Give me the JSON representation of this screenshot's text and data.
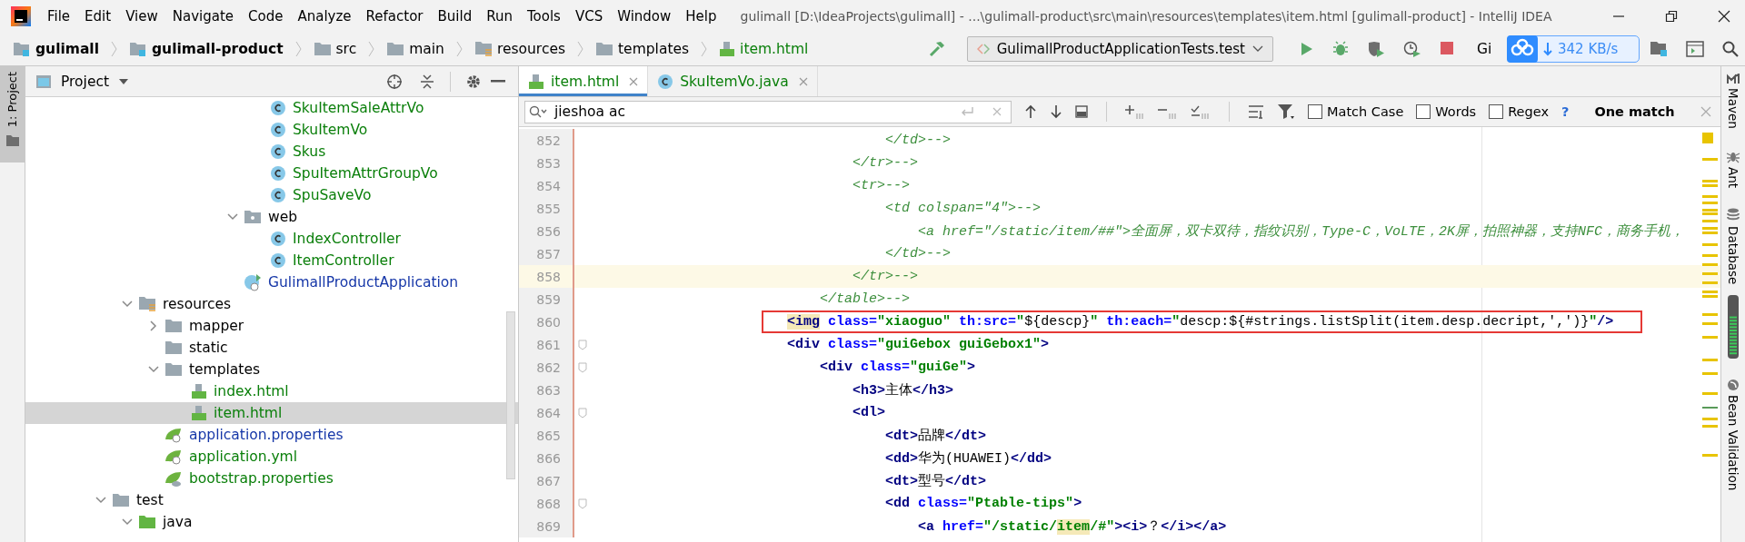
{
  "menu": [
    "File",
    "Edit",
    "View",
    "Navigate",
    "Code",
    "Analyze",
    "Refactor",
    "Build",
    "Run",
    "Tools",
    "VCS",
    "Window",
    "Help"
  ],
  "window": {
    "title": "gulimall [D:\\IdeaProjects\\gulimall] - ...\\gulimall-product\\src\\main\\resources\\templates\\item.html [gulimall-product] - IntelliJ IDEA"
  },
  "breadcrumbs": [
    {
      "label": "gulimall",
      "kind": "module"
    },
    {
      "label": "gulimall-product",
      "kind": "module"
    },
    {
      "label": "src",
      "kind": "folder"
    },
    {
      "label": "main",
      "kind": "folder"
    },
    {
      "label": "resources",
      "kind": "resources"
    },
    {
      "label": "templates",
      "kind": "folder"
    },
    {
      "label": "item.html",
      "kind": "html"
    }
  ],
  "toolbar": {
    "run_config": "GulimallProductApplicationTests.test",
    "vcs_label": "Gi",
    "speed_widget": "342 KB/s"
  },
  "left_stripe": {
    "label": "1: Project"
  },
  "project": {
    "title": "Project",
    "tree": [
      {
        "children": [
          {
            "children": [
              {
                "children": [
                  {
                    "children": [
                      {
                        "children": [
                          {
                            "children": [
                              {
                                "name": "SkuItemSaleAttrVo",
                                "kind": "class",
                                "color": "#0a7f0a",
                                "selected": false
                              },
                              {
                                "name": "SkuItemVo",
                                "kind": "class",
                                "color": "#0a7f0a",
                                "selected": false
                              },
                              {
                                "name": "Skus",
                                "kind": "class",
                                "color": "#0a7f0a",
                                "selected": false
                              },
                              {
                                "name": "SpuItemAttrGroupVo",
                                "kind": "class",
                                "color": "#0a7f0a",
                                "selected": false
                              },
                              {
                                "name": "SpuSaveVo",
                                "kind": "class",
                                "color": "#0a7f0a",
                                "selected": false
                              }
                            ]
                          },
                          {
                            "name": "web",
                            "kind": "package",
                            "color": "#000000",
                            "expanded": true,
                            "selected": false,
                            "children": [
                              {
                                "name": "IndexController",
                                "kind": "class",
                                "color": "#0a7f0a",
                                "selected": false
                              },
                              {
                                "name": "ItemController",
                                "kind": "class",
                                "color": "#0a7f0a",
                                "selected": false
                              }
                            ]
                          },
                          {
                            "name": "GulimallProductApplication",
                            "kind": "spring-class",
                            "color": "#1637a8",
                            "selected": false
                          }
                        ]
                      }
                    ]
                  }
                ]
              }
            ]
          },
          {
            "name": "resources",
            "kind": "resources",
            "color": "#000000",
            "expanded": true,
            "selected": false,
            "children": [
              {
                "name": "mapper",
                "kind": "folder",
                "color": "#000000",
                "expanded": false,
                "selected": false
              },
              {
                "name": "static",
                "kind": "folder",
                "color": "#000000",
                "selected": false
              },
              {
                "name": "templates",
                "kind": "folder",
                "color": "#000000",
                "expanded": true,
                "selected": false,
                "children": [
                  {
                    "name": "index.html",
                    "kind": "html",
                    "color": "#0a7f0a",
                    "selected": false
                  },
                  {
                    "name": "item.html",
                    "kind": "html",
                    "color": "#0a7f0a",
                    "selected": true
                  }
                ]
              },
              {
                "name": "application.properties",
                "kind": "spring-config",
                "color": "#1637a8",
                "selected": false
              },
              {
                "name": "application.yml",
                "kind": "spring-config",
                "color": "#0a7f0a",
                "selected": false
              },
              {
                "name": "bootstrap.properties",
                "kind": "spring-cloud",
                "color": "#0a7f0a",
                "selected": false
              }
            ]
          }
        ]
      },
      {
        "name": "test",
        "kind": "folder",
        "color": "#000000",
        "expanded": true,
        "selected": false,
        "children": [
          {
            "name": "java",
            "kind": "test-root",
            "color": "#000000",
            "expanded": true,
            "selected": false
          }
        ]
      }
    ]
  },
  "editor": {
    "tabs": [
      {
        "label": "item.html",
        "kind": "html",
        "selected": true
      },
      {
        "label": "SkuItemVo.java",
        "kind": "class",
        "selected": false
      }
    ],
    "find": {
      "value": "jieshoa ac",
      "options": [
        {
          "label": "Match Case",
          "checked": false
        },
        {
          "label": "Words",
          "checked": false
        },
        {
          "label": "Regex",
          "checked": false
        }
      ],
      "help": "?",
      "result": "One match"
    },
    "lines": [
      {
        "number": "852",
        "caret_line": false,
        "boxed": false,
        "fold_marker": false,
        "segments": [
          {
            "kind": "comment",
            "text": "                                    </td>-->"
          }
        ]
      },
      {
        "number": "853",
        "caret_line": false,
        "boxed": false,
        "fold_marker": false,
        "segments": [
          {
            "kind": "comment",
            "text": "                                </tr>-->"
          }
        ]
      },
      {
        "number": "854",
        "caret_line": false,
        "boxed": false,
        "fold_marker": false,
        "segments": [
          {
            "kind": "comment",
            "text": "                                <tr>-->"
          }
        ]
      },
      {
        "number": "855",
        "caret_line": false,
        "boxed": false,
        "fold_marker": false,
        "segments": [
          {
            "kind": "comment",
            "text": "                                    <td colspan=\"4\">-->"
          }
        ]
      },
      {
        "number": "856",
        "caret_line": false,
        "boxed": false,
        "fold_marker": false,
        "segments": [
          {
            "kind": "comment",
            "text": "                                        <a href=\"/static/item/##\">全面屏，双卡双待，指纹识别，Type-C，VoLTE，2K屏，拍照神器，支持NFC，商务手机，"
          }
        ]
      },
      {
        "number": "857",
        "caret_line": false,
        "boxed": false,
        "fold_marker": false,
        "segments": [
          {
            "kind": "comment",
            "text": "                                    </td>-->"
          }
        ]
      },
      {
        "number": "858",
        "caret_line": true,
        "boxed": false,
        "fold_marker": false,
        "segments": [
          {
            "kind": "comment",
            "text": "                                </tr>-->"
          }
        ]
      },
      {
        "number": "859",
        "caret_line": false,
        "boxed": false,
        "fold_marker": false,
        "segments": [
          {
            "kind": "comment",
            "text": "                            </table>-->"
          }
        ]
      },
      {
        "number": "860",
        "caret_line": false,
        "boxed": true,
        "fold_marker": false,
        "segments": [
          {
            "kind": "tag-match",
            "text": "                        <img"
          },
          {
            "kind": "attr",
            "text": " class="
          },
          {
            "kind": "value",
            "text": "\"xiaoguo\""
          },
          {
            "kind": "attr",
            "text": " th:src="
          },
          {
            "kind": "value",
            "text": "\""
          },
          {
            "kind": "expr",
            "text": "${descp}"
          },
          {
            "kind": "value",
            "text": "\""
          },
          {
            "kind": "attr",
            "text": " th:each="
          },
          {
            "kind": "value",
            "text": "\""
          },
          {
            "kind": "expr",
            "text": "descp:${#strings.listSplit(item.desp.decript,',')}"
          },
          {
            "kind": "value",
            "text": "\""
          },
          {
            "kind": "tag",
            "text": "/>"
          }
        ]
      },
      {
        "number": "861",
        "caret_line": false,
        "boxed": false,
        "fold_marker": true,
        "segments": [
          {
            "kind": "tag",
            "text": "                        <div"
          },
          {
            "kind": "attr",
            "text": " class="
          },
          {
            "kind": "value",
            "text": "\"guiGebox guiGebox1\""
          },
          {
            "kind": "tag",
            "text": ">"
          }
        ]
      },
      {
        "number": "862",
        "caret_line": false,
        "boxed": false,
        "fold_marker": true,
        "segments": [
          {
            "kind": "tag",
            "text": "                            <div"
          },
          {
            "kind": "attr",
            "text": " class="
          },
          {
            "kind": "value",
            "text": "\"guiGe\""
          },
          {
            "kind": "tag",
            "text": ">"
          }
        ]
      },
      {
        "number": "863",
        "caret_line": false,
        "boxed": false,
        "fold_marker": false,
        "segments": [
          {
            "kind": "tag",
            "text": "                                <h3>"
          },
          {
            "kind": "text",
            "text": "主体"
          },
          {
            "kind": "tag",
            "text": "</h3>"
          }
        ]
      },
      {
        "number": "864",
        "caret_line": false,
        "boxed": false,
        "fold_marker": true,
        "segments": [
          {
            "kind": "tag",
            "text": "                                <dl>"
          }
        ]
      },
      {
        "number": "865",
        "caret_line": false,
        "boxed": false,
        "fold_marker": false,
        "segments": [
          {
            "kind": "tag",
            "text": "                                    <dt>"
          },
          {
            "kind": "text",
            "text": "品牌"
          },
          {
            "kind": "tag",
            "text": "</dt>"
          }
        ]
      },
      {
        "number": "866",
        "caret_line": false,
        "boxed": false,
        "fold_marker": false,
        "segments": [
          {
            "kind": "tag",
            "text": "                                    <dd>"
          },
          {
            "kind": "text",
            "text": "华为(HUAWEI)"
          },
          {
            "kind": "tag",
            "text": "</dd>"
          }
        ]
      },
      {
        "number": "867",
        "caret_line": false,
        "boxed": false,
        "fold_marker": false,
        "segments": [
          {
            "kind": "tag",
            "text": "                                    <dt>"
          },
          {
            "kind": "text",
            "text": "型号"
          },
          {
            "kind": "tag",
            "text": "</dt>"
          }
        ]
      },
      {
        "number": "868",
        "caret_line": false,
        "boxed": false,
        "fold_marker": true,
        "segments": [
          {
            "kind": "tag",
            "text": "                                    <dd"
          },
          {
            "kind": "attr",
            "text": " class="
          },
          {
            "kind": "value",
            "text": "\"Ptable-tips\""
          },
          {
            "kind": "tag",
            "text": ">"
          }
        ]
      },
      {
        "number": "869",
        "caret_line": false,
        "boxed": false,
        "fold_marker": false,
        "segments": [
          {
            "kind": "tag",
            "text": "                                        <a"
          },
          {
            "kind": "attr",
            "text": " href="
          },
          {
            "kind": "value",
            "text": "\"/static/"
          },
          {
            "kind": "value-match",
            "text": "item"
          },
          {
            "kind": "value",
            "text": "/#\""
          },
          {
            "kind": "tag",
            "text": "><i>"
          },
          {
            "kind": "text",
            "text": "？"
          },
          {
            "kind": "tag",
            "text": "</i></a>"
          }
        ]
      }
    ]
  },
  "right_stripe": [
    {
      "label": "Maven",
      "kind": "maven"
    },
    {
      "label": "Ant",
      "kind": "ant"
    },
    {
      "label": "Database",
      "kind": "database"
    },
    {
      "label": "Bean Validation",
      "kind": "bean"
    }
  ]
}
